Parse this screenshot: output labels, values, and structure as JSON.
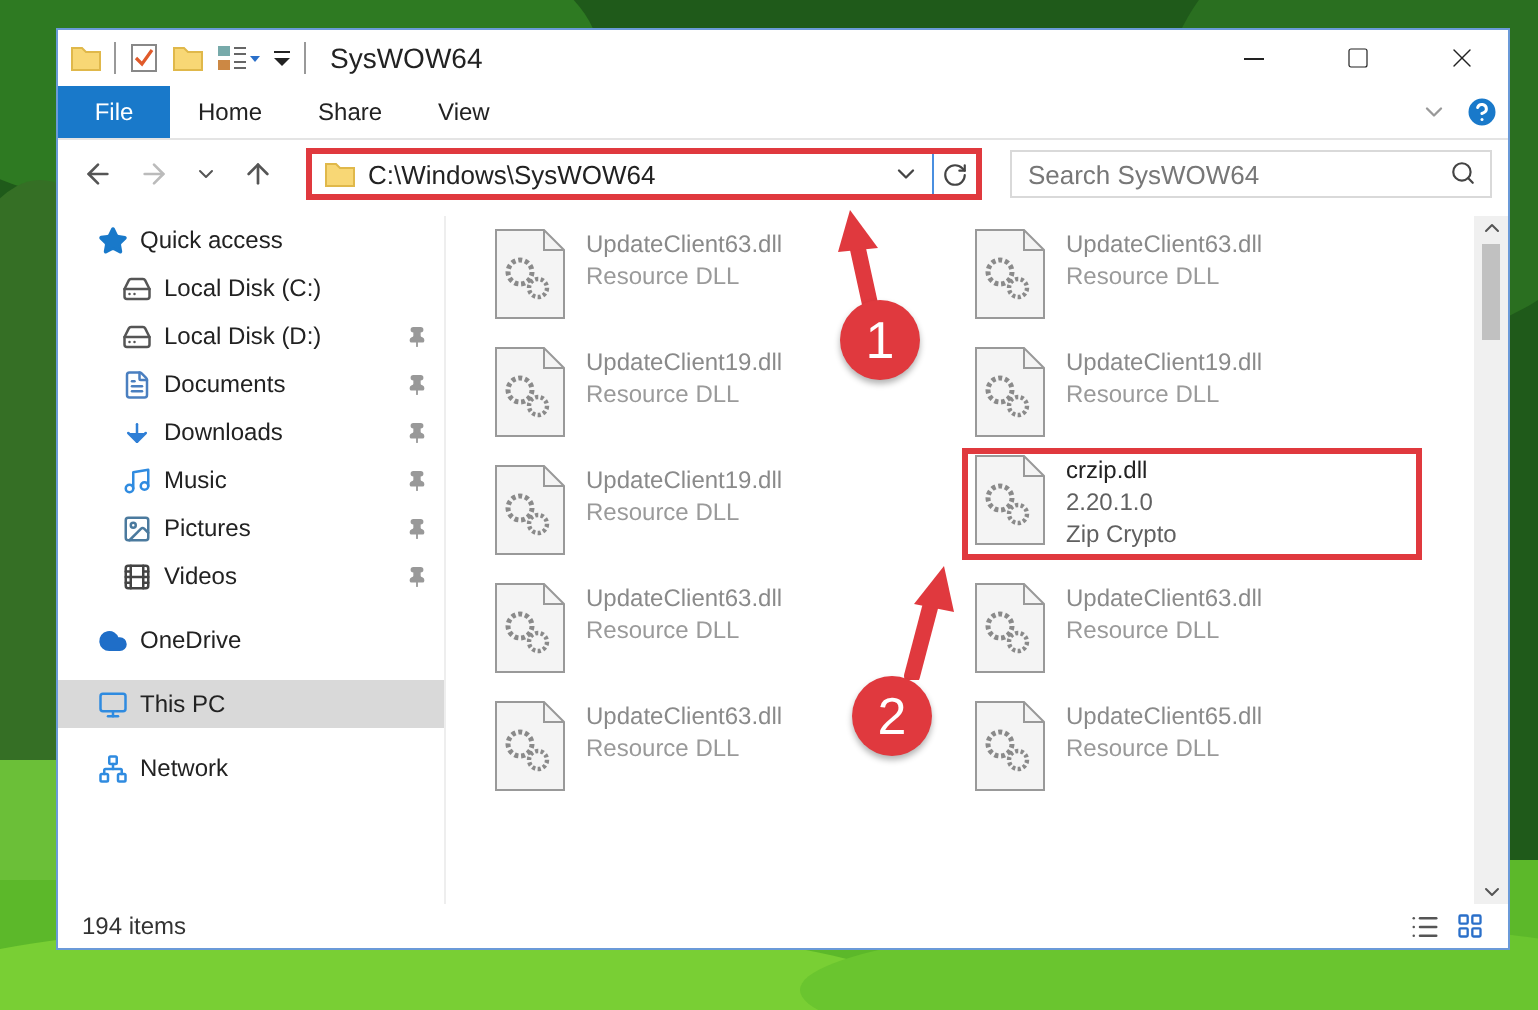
{
  "window": {
    "title": "SysWOW64"
  },
  "ribbon_tabs": [
    {
      "label": "File",
      "kind": "menu",
      "selected": false
    },
    {
      "label": "Home",
      "kind": "tab",
      "selected": false
    },
    {
      "label": "Share",
      "kind": "tab",
      "selected": false
    },
    {
      "label": "View",
      "kind": "tab",
      "selected": false
    }
  ],
  "address_bar": {
    "path": "C:\\Windows\\SysWOW64",
    "outlined": true
  },
  "search": {
    "placeholder": "Search SysWOW64"
  },
  "sidebar": {
    "items": [
      {
        "label": "Quick access",
        "kind": "star",
        "selected": false,
        "children": [
          {
            "label": "Local Disk (C:)",
            "kind": "drive",
            "pinned": false,
            "selected": false
          },
          {
            "label": "Local Disk (D:)",
            "kind": "drive",
            "pinned": true,
            "selected": false
          },
          {
            "label": "Documents",
            "kind": "document",
            "pinned": true,
            "selected": false
          },
          {
            "label": "Downloads",
            "kind": "download",
            "pinned": true,
            "selected": false
          },
          {
            "label": "Music",
            "kind": "music",
            "pinned": true,
            "selected": false
          },
          {
            "label": "Pictures",
            "kind": "pictures",
            "pinned": true,
            "selected": false
          },
          {
            "label": "Videos",
            "kind": "videos",
            "pinned": true,
            "selected": false
          }
        ]
      },
      {
        "label": "OneDrive",
        "kind": "cloud",
        "selected": false
      },
      {
        "label": "This PC",
        "kind": "pc",
        "selected": true
      },
      {
        "label": "Network",
        "kind": "network",
        "selected": false
      }
    ]
  },
  "files": [
    {
      "name": "UpdateClient63.dll",
      "details": [
        "Resource DLL"
      ],
      "blurred": true,
      "outlined": false
    },
    {
      "name": "UpdateClient63.dll",
      "details": [
        "Resource DLL"
      ],
      "blurred": true,
      "outlined": false
    },
    {
      "name": "UpdateClient19.dll",
      "details": [
        "Resource DLL"
      ],
      "blurred": true,
      "outlined": false
    },
    {
      "name": "UpdateClient19.dll",
      "details": [
        "Resource DLL"
      ],
      "blurred": true,
      "outlined": false
    },
    {
      "name": "UpdateClient19.dll",
      "details": [
        "Resource DLL"
      ],
      "blurred": true,
      "outlined": false
    },
    {
      "name": "crzip.dll",
      "details": [
        "2.20.1.0",
        "Zip Crypto"
      ],
      "blurred": false,
      "outlined": true
    },
    {
      "name": "UpdateClient63.dll",
      "details": [
        "Resource DLL"
      ],
      "blurred": true,
      "outlined": false
    },
    {
      "name": "UpdateClient63.dll",
      "details": [
        "Resource DLL"
      ],
      "blurred": true,
      "outlined": false
    },
    {
      "name": "UpdateClient63.dll",
      "details": [
        "Resource DLL"
      ],
      "blurred": true,
      "outlined": false
    },
    {
      "name": "UpdateClient65.dll",
      "details": [
        "Resource DLL"
      ],
      "blurred": true,
      "outlined": false
    }
  ],
  "status_bar": {
    "item_count": "194 items"
  },
  "annotations": [
    {
      "number": "1"
    },
    {
      "number": "2"
    }
  ]
}
